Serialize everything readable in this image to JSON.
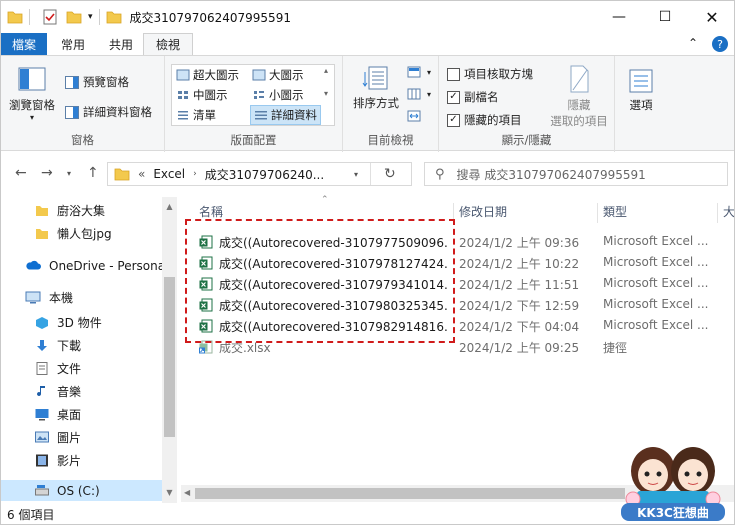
{
  "window": {
    "title": "成交310797062407995591"
  },
  "tabs": [
    {
      "label": "檔案"
    },
    {
      "label": "常用"
    },
    {
      "label": "共用"
    },
    {
      "label": "檢視"
    }
  ],
  "ribbon": {
    "pane_group": {
      "label": "窗格",
      "nav_pane": "瀏覽窗格",
      "preview_pane": "預覽窗格",
      "details_pane": "詳細資料窗格"
    },
    "layout_group": {
      "label": "版面配置",
      "items": [
        "超大圖示",
        "大圖示",
        "中圖示",
        "小圖示",
        "清單",
        "詳細資料"
      ]
    },
    "current_view_group": {
      "label": "目前檢視",
      "sort": "排序方式"
    },
    "show_hide_group": {
      "label": "顯示/隱藏",
      "item_checkboxes": "項目核取方塊",
      "extensions": "副檔名",
      "hidden_items": "隱藏的項目",
      "hide_selected_1": "隱藏",
      "hide_selected_2": "選取的項目"
    },
    "options": "選項"
  },
  "address": {
    "prefix": "«",
    "crumb1": "Excel",
    "crumb2": "成交31079706240...",
    "search_placeholder": "搜尋 成交310797062407995591"
  },
  "sidebar": [
    {
      "label": "廚浴大集"
    },
    {
      "label": "懶人包jpg"
    },
    {
      "label": "OneDrive - Personal"
    },
    {
      "label": "本機"
    },
    {
      "label": "3D 物件"
    },
    {
      "label": "下載"
    },
    {
      "label": "文件"
    },
    {
      "label": "音樂"
    },
    {
      "label": "桌面"
    },
    {
      "label": "圖片"
    },
    {
      "label": "影片"
    },
    {
      "label": "OS (C:)"
    }
  ],
  "columns": [
    "名稱",
    "修改日期",
    "類型",
    "大"
  ],
  "files": [
    {
      "name": "成交((Autorecovered-3107977509096...",
      "date": "2024/1/2 上午 09:36",
      "type": "Microsoft Excel ..."
    },
    {
      "name": "成交((Autorecovered-3107978127424...",
      "date": "2024/1/2 上午 10:22",
      "type": "Microsoft Excel ..."
    },
    {
      "name": "成交((Autorecovered-3107979341014...",
      "date": "2024/1/2 上午 11:51",
      "type": "Microsoft Excel ..."
    },
    {
      "name": "成交((Autorecovered-3107980325345...",
      "date": "2024/1/2 下午 12:59",
      "type": "Microsoft Excel ..."
    },
    {
      "name": "成交((Autorecovered-3107982914816...",
      "date": "2024/1/2 下午 04:04",
      "type": "Microsoft Excel ..."
    },
    {
      "name": "成交.xlsx",
      "date": "2024/1/2 上午 09:25",
      "type": "捷徑"
    }
  ],
  "status": {
    "count": "6 個項目"
  },
  "watermark": "KK3C狂想曲",
  "colors": {
    "accent": "#1a6fc4",
    "excel_green": "#1e7145",
    "highlight": "#d01b1b"
  }
}
